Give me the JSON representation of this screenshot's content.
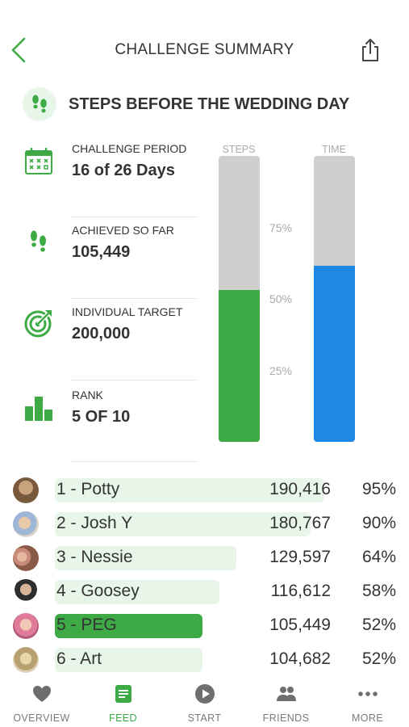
{
  "header": {
    "title": "CHALLENGE SUMMARY",
    "back_icon": "chevron-left-icon",
    "share_icon": "share-icon",
    "accent_color": "#3daa45"
  },
  "challenge": {
    "name": "STEPS BEFORE THE WEDDING DAY",
    "icon": "footsteps-icon"
  },
  "stats": [
    {
      "label": "CHALLENGE PERIOD",
      "value": "16 of 26 Days",
      "icon": "calendar-icon"
    },
    {
      "label": "ACHIEVED SO FAR",
      "value": "105,449",
      "icon": "footsteps-icon"
    },
    {
      "label": "INDIVIDUAL TARGET",
      "value": "200,000",
      "icon": "target-icon"
    },
    {
      "label": "RANK",
      "value": "5 OF 10",
      "icon": "bar-chart-icon"
    }
  ],
  "progress": {
    "steps_label": "STEPS",
    "time_label": "TIME",
    "steps_fraction": 0.53,
    "time_fraction": 0.615,
    "steps_color": "#3daa45",
    "time_color": "#1e88e5",
    "track_color": "#cfcfcf",
    "percent_labels": [
      "75%",
      "50%",
      "25%"
    ]
  },
  "leaderboard": [
    {
      "name": "1 - Potty",
      "steps": "190,416",
      "percent": "95%",
      "fraction": 0.95,
      "me": false
    },
    {
      "name": "2 - Josh Y",
      "steps": "180,767",
      "percent": "90%",
      "fraction": 0.9,
      "me": false
    },
    {
      "name": "3 - Nessie",
      "steps": "129,597",
      "percent": "64%",
      "fraction": 0.64,
      "me": false
    },
    {
      "name": "4 - Goosey",
      "steps": "116,612",
      "percent": "58%",
      "fraction": 0.58,
      "me": false
    },
    {
      "name": "5 - PEG",
      "steps": "105,449",
      "percent": "52%",
      "fraction": 0.52,
      "me": true
    },
    {
      "name": "6 - Art",
      "steps": "104,682",
      "percent": "52%",
      "fraction": 0.52,
      "me": false
    }
  ],
  "tabs": [
    {
      "label": "OVERVIEW",
      "icon": "heart-icon",
      "active": false
    },
    {
      "label": "FEED",
      "icon": "feed-icon",
      "active": true
    },
    {
      "label": "START",
      "icon": "play-icon",
      "active": false
    },
    {
      "label": "FRIENDS",
      "icon": "friends-icon",
      "active": false
    },
    {
      "label": "MORE",
      "icon": "more-icon",
      "active": false
    }
  ]
}
